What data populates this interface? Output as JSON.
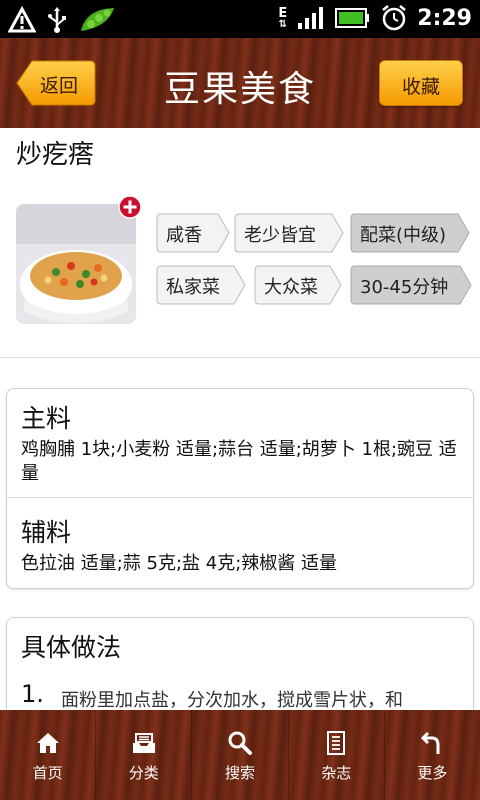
{
  "status_bar": {
    "time": "2:29",
    "network_type": "E"
  },
  "header": {
    "back_label": "返回",
    "title": "豆果美食",
    "favorite_label": "收藏"
  },
  "recipe": {
    "name": "炒疙瘩",
    "tags": [
      "咸香",
      "老少皆宜",
      "配菜(中级)",
      "私家菜",
      "大众菜",
      "30-45分钟"
    ]
  },
  "ingredients": {
    "main_title": "主料",
    "main_text": "鸡胸脯 1块;小麦粉 适量;蒜台 适量;胡萝卜 1根;豌豆 适量",
    "aux_title": "辅料",
    "aux_text": "色拉油 适量;蒜 5克;盐 4克;辣椒酱 适量"
  },
  "method": {
    "title": "具体做法",
    "step_number": "1.",
    "step_text": "面粉里加点盐，分次加水，搅成雪片状，和"
  },
  "bottom_nav": [
    {
      "label": "首页",
      "icon": "home-icon"
    },
    {
      "label": "分类",
      "icon": "tray-icon"
    },
    {
      "label": "搜索",
      "icon": "search-icon"
    },
    {
      "label": "杂志",
      "icon": "magazine-icon"
    },
    {
      "label": "更多",
      "icon": "more-icon"
    }
  ],
  "colors": {
    "button_gradient_top": "#ffd04a",
    "button_gradient_bottom": "#f59a00",
    "wood_brown": "#6b2713"
  }
}
